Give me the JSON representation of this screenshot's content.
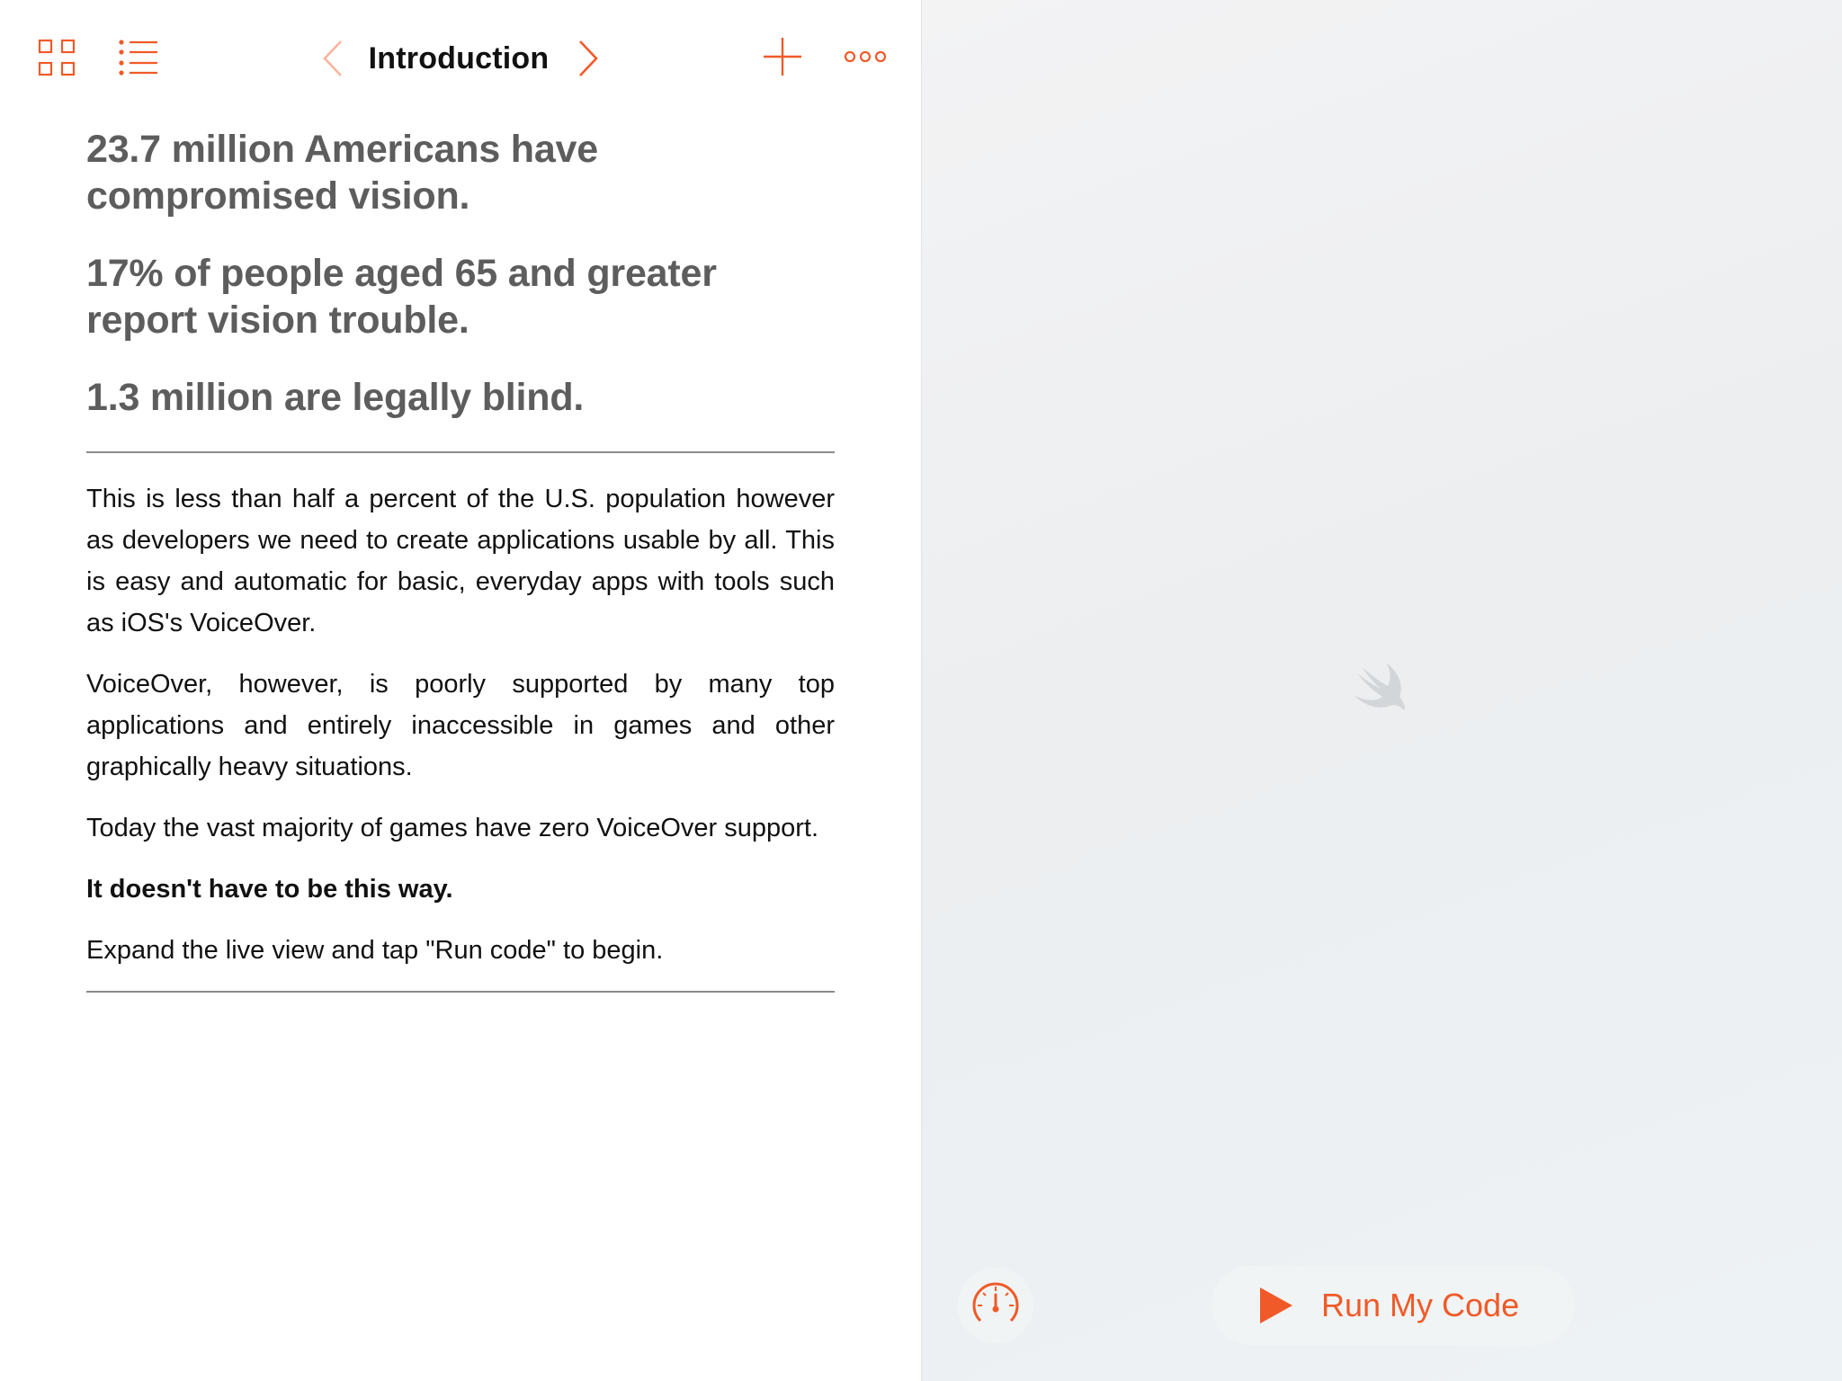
{
  "toolbar": {
    "title": "Introduction",
    "icons": {
      "grid": "grid-icon",
      "list": "list-icon",
      "prev": "chevron-left-icon",
      "next": "chevron-right-icon",
      "add": "plus-icon",
      "more": "more-icon"
    }
  },
  "colors": {
    "accent": "#f05a28",
    "accent_disabled": "#f7b59c",
    "stat_text": "#5d5d5d",
    "body_text": "#111111",
    "live_view_bg": "#eceef0"
  },
  "content": {
    "stats": [
      "23.7 million Americans have compromised vision.",
      "17% of people aged 65 and greater report vision trouble.",
      "1.3 million are legally blind."
    ],
    "paragraphs": [
      "This is less than half a percent of the U.S. population however as developers we need to create applications usable by all. This is easy and automatic for basic, everyday apps with tools such as iOS's VoiceOver.",
      "VoiceOver, however, is poorly supported by many top applications and entirely inaccessible in games and other graphically heavy situations.",
      "Today the vast majority of games have zero VoiceOver support.",
      "It doesn't have to be this way.",
      "Expand the live view and tap \"Run code\" to begin."
    ]
  },
  "live_view": {
    "logo": "swift-logo-icon",
    "speed_icon": "speedometer-icon",
    "run_button_label": "Run My Code"
  }
}
